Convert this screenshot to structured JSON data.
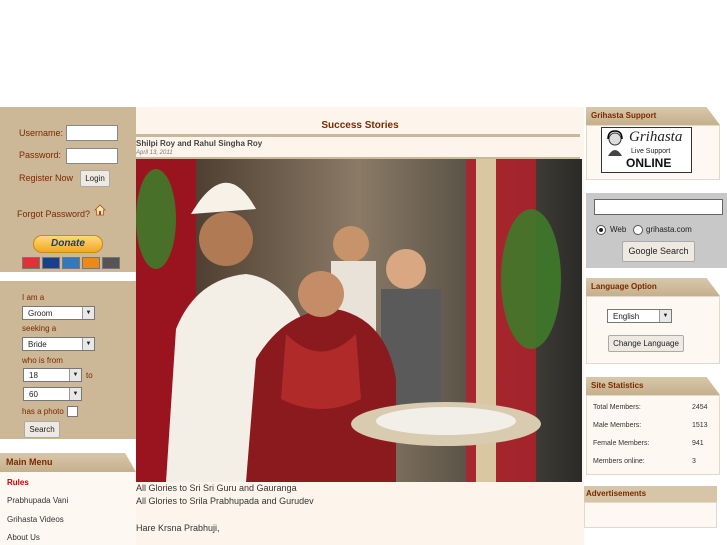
{
  "login": {
    "username_label": "Username:",
    "password_label": "Password:",
    "register_label": "Register Now",
    "login_button": "Login",
    "forgot_label": "Forgot Password?",
    "donate_label": "Donate",
    "card_icons": [
      "mastercard-icon",
      "visa-icon",
      "amex-icon",
      "discover-icon",
      "bank-icon"
    ]
  },
  "search": {
    "i_am_label": "I am a",
    "i_am_value": "Groom",
    "seeking_label": "seeking a",
    "seeking_value": "Bride",
    "from_label": "who is from",
    "age_from": "18",
    "to_label": "to",
    "age_to": "60",
    "photo_label": "has a photo",
    "search_button": "Search"
  },
  "main_menu": {
    "title": "Main Menu",
    "items": [
      "Rules",
      "Prabhupada Vani",
      "Grihasta Videos",
      "About Us"
    ]
  },
  "article": {
    "heading": "Success Stories",
    "subtitle": "Shilpi Roy and Rahul Singha Roy",
    "date": "April 13, 2011",
    "line1": "All Glories to Sri Sri Guru and Gauranga",
    "line2": "All Glories to Srila Prabhupada and Gurudev",
    "line3": "Hare Krsna Prabhuji,"
  },
  "support": {
    "title": "Grihasta Support",
    "logo_word": "Grihasta",
    "logo_line": "Live Support",
    "logo_status": "ONLINE"
  },
  "google": {
    "search_value": "",
    "radio_web": "Web",
    "radio_site": "grihasta.com",
    "button": "Google Search"
  },
  "language": {
    "title": "Language Option",
    "selected": "English",
    "button": "Change Language"
  },
  "stats": {
    "title": "Site Statistics",
    "rows": [
      {
        "label": "Total Members:",
        "value": "2454"
      },
      {
        "label": "Male Members:",
        "value": "1513"
      },
      {
        "label": "Female Members:",
        "value": "941"
      },
      {
        "label": "Members online:",
        "value": "3"
      }
    ]
  },
  "ads": {
    "title": "Advertisements"
  },
  "colors": {
    "panel": "#ccb797",
    "heading": "#7a2a00",
    "content_bg": "#fdf5ec"
  }
}
